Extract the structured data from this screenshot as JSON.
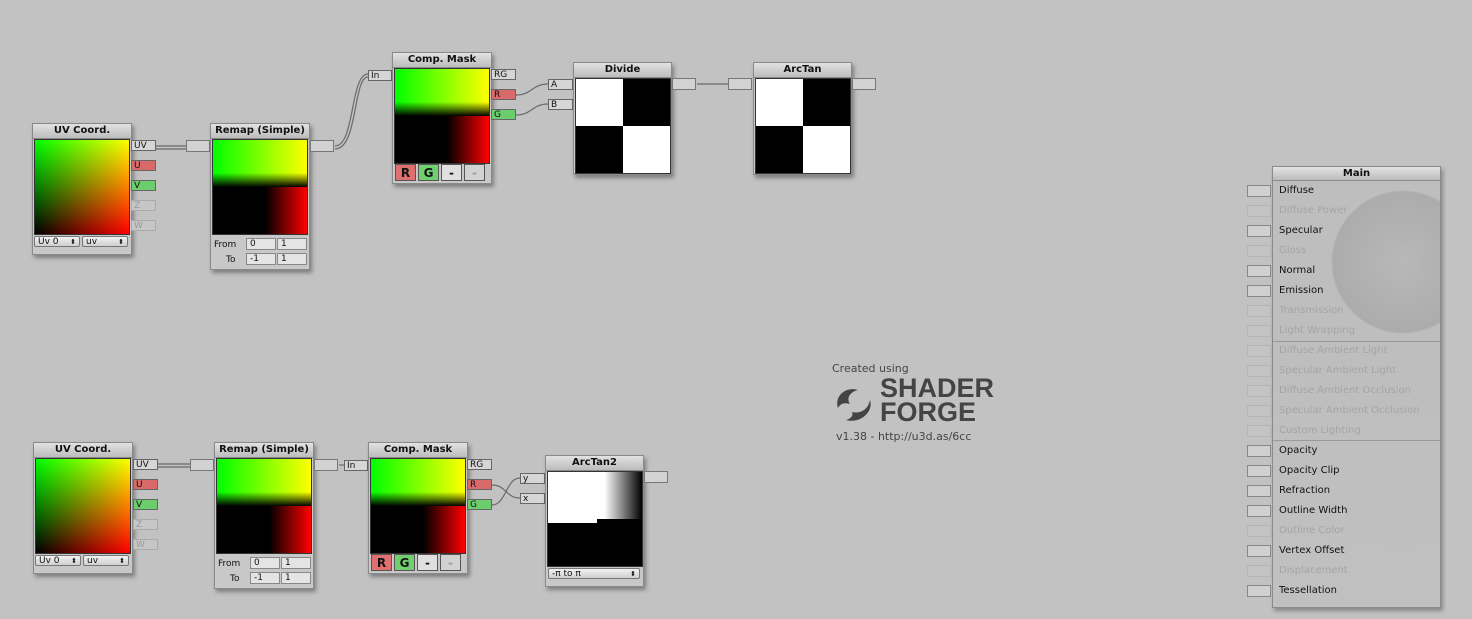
{
  "graph_top": {
    "uv_node": {
      "title": "UV Coord.",
      "ports": [
        "UV",
        "U",
        "V",
        "Z",
        "W"
      ],
      "uv_select": "Uv 0",
      "mode_select": "uv"
    },
    "remap_node": {
      "title": "Remap (Simple)",
      "from_label": "From",
      "to_label": "To",
      "from_min": "0",
      "from_max": "1",
      "to_min": "-1",
      "to_max": "1"
    },
    "mask_node": {
      "title": "Comp. Mask",
      "in_label": "In",
      "outputs": [
        "RG",
        "R",
        "G"
      ],
      "channels": [
        "R",
        "G",
        "-",
        "-"
      ]
    },
    "divide_node": {
      "title": "Divide",
      "inputs": [
        "A",
        "B"
      ]
    },
    "arctan_node": {
      "title": "ArcTan"
    }
  },
  "graph_bottom": {
    "uv_node": {
      "title": "UV Coord.",
      "ports": [
        "UV",
        "U",
        "V",
        "Z",
        "W"
      ],
      "uv_select": "Uv 0",
      "mode_select": "uv"
    },
    "remap_node": {
      "title": "Remap (Simple)",
      "from_label": "From",
      "to_label": "To",
      "from_min": "0",
      "from_max": "1",
      "to_min": "-1",
      "to_max": "1"
    },
    "mask_node": {
      "title": "Comp. Mask",
      "in_label": "In",
      "outputs": [
        "RG",
        "R",
        "G"
      ],
      "channels": [
        "R",
        "G",
        "-",
        "-"
      ]
    },
    "arctan2_node": {
      "title": "ArcTan2",
      "inputs": [
        "y",
        "x"
      ],
      "mode_select": "-π to π"
    }
  },
  "branding": {
    "created_using": "Created using",
    "brand_line1": "SHADER",
    "brand_line2": "FORGE",
    "version": "v1.38 - http://u3d.as/6cc"
  },
  "main_node": {
    "title": "Main",
    "inputs": [
      {
        "label": "Diffuse",
        "enabled": true
      },
      {
        "label": "Diffuse Power",
        "enabled": false
      },
      {
        "label": "Specular",
        "enabled": true
      },
      {
        "label": "Gloss",
        "enabled": false
      },
      {
        "label": "Normal",
        "enabled": true
      },
      {
        "label": "Emission",
        "enabled": true
      },
      {
        "label": "Transmission",
        "enabled": false
      },
      {
        "label": "Light Wrapping",
        "enabled": false
      },
      {
        "label": "Diffuse Ambient Light",
        "enabled": false
      },
      {
        "label": "Specular Ambient Light",
        "enabled": false
      },
      {
        "label": "Diffuse Ambient Occlusion",
        "enabled": false
      },
      {
        "label": "Specular Ambient Occlusion",
        "enabled": false
      },
      {
        "label": "Custom Lighting",
        "enabled": false
      },
      {
        "label": "Opacity",
        "enabled": true
      },
      {
        "label": "Opacity Clip",
        "enabled": true
      },
      {
        "label": "Refraction",
        "enabled": true
      },
      {
        "label": "Outline Width",
        "enabled": true
      },
      {
        "label": "Outline Color",
        "enabled": false
      },
      {
        "label": "Vertex Offset",
        "enabled": true
      },
      {
        "label": "Displacement",
        "enabled": false
      },
      {
        "label": "Tessellation",
        "enabled": true
      }
    ]
  },
  "colors": {
    "background": "#c2c2c2",
    "port_red": "#d86a6a",
    "port_green": "#6ccd6c"
  }
}
